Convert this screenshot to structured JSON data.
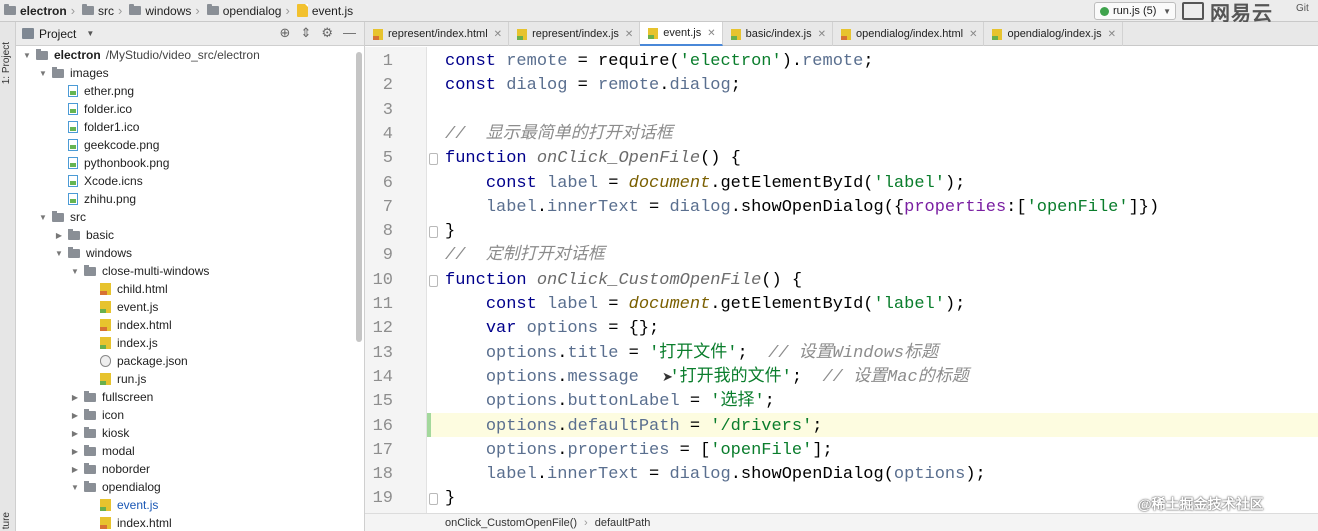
{
  "breadcrumb": [
    {
      "label": "electron",
      "icon": "folder-icon"
    },
    {
      "label": "src",
      "icon": "folder-icon"
    },
    {
      "label": "windows",
      "icon": "folder-icon"
    },
    {
      "label": "opendialog",
      "icon": "folder-icon"
    },
    {
      "label": "event.js",
      "icon": "js-file-icon"
    }
  ],
  "run_config": {
    "label": "run.js (5)"
  },
  "watermark_top": {
    "text": "网易云"
  },
  "git_label": "Git",
  "side_strip": {
    "project_label": "1: Project",
    "bottom_label": "ture"
  },
  "project_panel": {
    "title": "Project",
    "tree": [
      {
        "label": "electron",
        "path": "/MyStudio/video_src/electron",
        "type": "folder",
        "depth": 0,
        "expanded": true,
        "bold": true
      },
      {
        "label": "images",
        "type": "folder",
        "depth": 1,
        "expanded": true
      },
      {
        "label": "ether.png",
        "type": "png",
        "depth": 2
      },
      {
        "label": "folder.ico",
        "type": "png",
        "depth": 2
      },
      {
        "label": "folder1.ico",
        "type": "png",
        "depth": 2
      },
      {
        "label": "geekcode.png",
        "type": "png",
        "depth": 2
      },
      {
        "label": "pythonbook.png",
        "type": "png",
        "depth": 2
      },
      {
        "label": "Xcode.icns",
        "type": "png",
        "depth": 2
      },
      {
        "label": "zhihu.png",
        "type": "png",
        "depth": 2
      },
      {
        "label": "src",
        "type": "folder",
        "depth": 1,
        "expanded": true
      },
      {
        "label": "basic",
        "type": "folder",
        "depth": 2,
        "expanded": false
      },
      {
        "label": "windows",
        "type": "folder",
        "depth": 2,
        "expanded": true
      },
      {
        "label": "close-multi-windows",
        "type": "folder",
        "depth": 3,
        "expanded": true
      },
      {
        "label": "child.html",
        "type": "html",
        "depth": 4
      },
      {
        "label": "event.js",
        "type": "js",
        "depth": 4
      },
      {
        "label": "index.html",
        "type": "html",
        "depth": 4
      },
      {
        "label": "index.js",
        "type": "js",
        "depth": 4
      },
      {
        "label": "package.json",
        "type": "json",
        "depth": 4
      },
      {
        "label": "run.js",
        "type": "js",
        "depth": 4
      },
      {
        "label": "fullscreen",
        "type": "folder",
        "depth": 3,
        "expanded": false
      },
      {
        "label": "icon",
        "type": "folder",
        "depth": 3,
        "expanded": false
      },
      {
        "label": "kiosk",
        "type": "folder",
        "depth": 3,
        "expanded": false
      },
      {
        "label": "modal",
        "type": "folder",
        "depth": 3,
        "expanded": false
      },
      {
        "label": "noborder",
        "type": "folder",
        "depth": 3,
        "expanded": false
      },
      {
        "label": "opendialog",
        "type": "folder",
        "depth": 3,
        "expanded": true
      },
      {
        "label": "event.js",
        "type": "js",
        "depth": 4,
        "selected": true
      },
      {
        "label": "index.html",
        "type": "html",
        "depth": 4
      }
    ]
  },
  "tabs": [
    {
      "label": "represent/index.html",
      "type": "html",
      "active": false
    },
    {
      "label": "represent/index.js",
      "type": "js",
      "active": false
    },
    {
      "label": "event.js",
      "type": "js",
      "active": true
    },
    {
      "label": "basic/index.js",
      "type": "js",
      "active": false
    },
    {
      "label": "opendialog/index.html",
      "type": "html",
      "active": false
    },
    {
      "label": "opendialog/index.js",
      "type": "js",
      "active": false
    }
  ],
  "editor": {
    "current_line": 16,
    "lines": [
      [
        [
          "k",
          "const "
        ],
        [
          "v",
          "remote"
        ],
        [
          "n",
          " = "
        ],
        [
          "n",
          "require("
        ],
        [
          "s",
          "'electron'"
        ],
        [
          "n",
          ")."
        ],
        [
          "v",
          "remote"
        ],
        [
          "n",
          ";"
        ]
      ],
      [
        [
          "k",
          "const "
        ],
        [
          "v",
          "dialog"
        ],
        [
          "n",
          " = "
        ],
        [
          "v",
          "remote"
        ],
        [
          "n",
          "."
        ],
        [
          "v",
          "dialog"
        ],
        [
          "n",
          ";"
        ]
      ],
      [],
      [
        [
          "c",
          "//  显示最简单的打开对话框"
        ]
      ],
      [
        [
          "k",
          "function "
        ],
        [
          "it",
          "onClick_OpenFile"
        ],
        [
          "n",
          "() {"
        ]
      ],
      [
        [
          "n",
          "    "
        ],
        [
          "k",
          "const "
        ],
        [
          "v",
          "label"
        ],
        [
          "n",
          " = "
        ],
        [
          "g",
          "document"
        ],
        [
          "n",
          "."
        ],
        [
          "n",
          "getElementById("
        ],
        [
          "s",
          "'label'"
        ],
        [
          "n",
          ");"
        ]
      ],
      [
        [
          "n",
          "    "
        ],
        [
          "v",
          "label"
        ],
        [
          "n",
          "."
        ],
        [
          "v",
          "innerText"
        ],
        [
          "n",
          " = "
        ],
        [
          "v",
          "dialog"
        ],
        [
          "n",
          "."
        ],
        [
          "n",
          "showOpenDialog({"
        ],
        [
          "p",
          "properties"
        ],
        [
          "n",
          ":["
        ],
        [
          "s",
          "'openFile'"
        ],
        [
          "n",
          "]})"
        ]
      ],
      [
        [
          "n",
          "}"
        ]
      ],
      [
        [
          "c",
          "//  定制打开对话框"
        ]
      ],
      [
        [
          "k",
          "function "
        ],
        [
          "it",
          "onClick_CustomOpenFile"
        ],
        [
          "n",
          "() {"
        ]
      ],
      [
        [
          "n",
          "    "
        ],
        [
          "k",
          "const "
        ],
        [
          "v",
          "label"
        ],
        [
          "n",
          " = "
        ],
        [
          "g",
          "document"
        ],
        [
          "n",
          "."
        ],
        [
          "n",
          "getElementById("
        ],
        [
          "s",
          "'label'"
        ],
        [
          "n",
          ");"
        ]
      ],
      [
        [
          "n",
          "    "
        ],
        [
          "k",
          "var "
        ],
        [
          "v",
          "options"
        ],
        [
          "n",
          " = {};"
        ]
      ],
      [
        [
          "n",
          "    "
        ],
        [
          "v",
          "options"
        ],
        [
          "n",
          "."
        ],
        [
          "v",
          "title"
        ],
        [
          "n",
          " = "
        ],
        [
          "s",
          "'打开文件'"
        ],
        [
          "n",
          ";  "
        ],
        [
          "c",
          "// 设置Windows标题"
        ]
      ],
      [
        [
          "n",
          "    "
        ],
        [
          "v",
          "options"
        ],
        [
          "n",
          "."
        ],
        [
          "v",
          "message"
        ],
        [
          "n",
          "   "
        ],
        [
          "s",
          "'打开我的文件'"
        ],
        [
          "n",
          ";  "
        ],
        [
          "c",
          "// 设置Mac的标题"
        ]
      ],
      [
        [
          "n",
          "    "
        ],
        [
          "v",
          "options"
        ],
        [
          "n",
          "."
        ],
        [
          "v",
          "buttonLabel"
        ],
        [
          "n",
          " = "
        ],
        [
          "s",
          "'选择'"
        ],
        [
          "n",
          ";"
        ]
      ],
      [
        [
          "n",
          "    "
        ],
        [
          "v",
          "options"
        ],
        [
          "n",
          "."
        ],
        [
          "v",
          "defaultPath"
        ],
        [
          "n",
          " = "
        ],
        [
          "s",
          "'/drivers'"
        ],
        [
          "n",
          ";"
        ]
      ],
      [
        [
          "n",
          "    "
        ],
        [
          "v",
          "options"
        ],
        [
          "n",
          "."
        ],
        [
          "v",
          "properties"
        ],
        [
          "n",
          " = ["
        ],
        [
          "s",
          "'openFile'"
        ],
        [
          "n",
          "];"
        ]
      ],
      [
        [
          "n",
          "    "
        ],
        [
          "v",
          "label"
        ],
        [
          "n",
          "."
        ],
        [
          "v",
          "innerText"
        ],
        [
          "n",
          " = "
        ],
        [
          "v",
          "dialog"
        ],
        [
          "n",
          "."
        ],
        [
          "n",
          "showOpenDialog("
        ],
        [
          "v",
          "options"
        ],
        [
          "n",
          ");"
        ]
      ],
      [
        [
          "n",
          "}"
        ]
      ]
    ]
  },
  "status": {
    "crumbs": [
      "onClick_CustomOpenFile()",
      "defaultPath"
    ]
  },
  "watermark_bottom": {
    "text": "@稀土掘金技术社区"
  }
}
